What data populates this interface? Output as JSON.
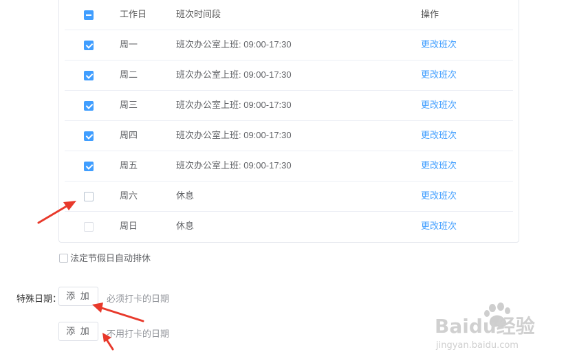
{
  "table": {
    "headers": {
      "workday": "工作日",
      "shift": "班次时间段",
      "action": "操作"
    },
    "rows": [
      {
        "day": "周一",
        "shift": "班次办公室上班: 09:00-17:30",
        "action": "更改班次",
        "checked": true
      },
      {
        "day": "周二",
        "shift": "班次办公室上班: 09:00-17:30",
        "action": "更改班次",
        "checked": true
      },
      {
        "day": "周三",
        "shift": "班次办公室上班: 09:00-17:30",
        "action": "更改班次",
        "checked": true
      },
      {
        "day": "周四",
        "shift": "班次办公室上班: 09:00-17:30",
        "action": "更改班次",
        "checked": true
      },
      {
        "day": "周五",
        "shift": "班次办公室上班: 09:00-17:30",
        "action": "更改班次",
        "checked": true
      },
      {
        "day": "周六",
        "shift": "休息",
        "action": "更改班次",
        "checked": false
      },
      {
        "day": "周日",
        "shift": "休息",
        "action": "更改班次",
        "checked": false
      }
    ]
  },
  "holiday_checkbox": {
    "label": "法定节假日自动排休",
    "checked": false
  },
  "special_dates": {
    "label": "特殊日期：",
    "add_required_label": "添 加",
    "required_hint": "必须打卡的日期",
    "add_exempt_label": "添 加",
    "exempt_hint": "不用打卡的日期"
  },
  "watermark": {
    "brand": "Baidu经验",
    "url": "jingyan.baidu.com"
  },
  "colors": {
    "accent": "#409eff",
    "arrow": "#e8392b",
    "border": "#ebeef5"
  }
}
